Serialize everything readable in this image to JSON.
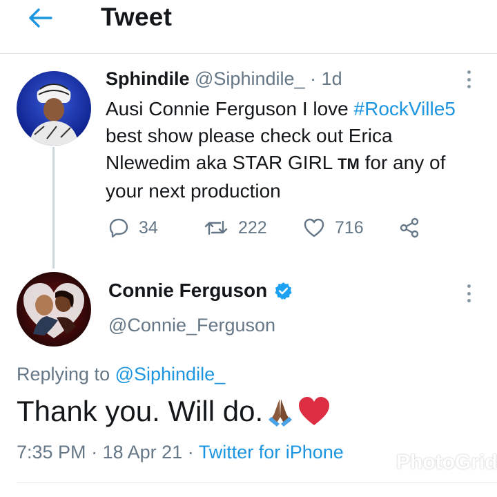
{
  "header": {
    "title": "Tweet"
  },
  "tweet1": {
    "name": "Sphindile",
    "handle": "@Siphindile_",
    "dot": "·",
    "time": "1d",
    "text_line1": "Ausi Connie Ferguson I love ",
    "hashtag": "#RockVille5",
    "text_line2": "best show please check out Erica",
    "text_line3_a": "Nlewedim aka STAR GIRL ",
    "tm": "TM",
    "text_line3_b": " for any of",
    "text_line4": "your next production",
    "replies": "34",
    "retweets": "222",
    "likes": "716"
  },
  "tweet2": {
    "name": "Connie Ferguson",
    "handle": "@Connie_Ferguson",
    "replying_prefix": "Replying to ",
    "replying_to": "@Siphindile_",
    "text": "Thank you. Will do.",
    "time": "7:35 PM",
    "sep1": "·",
    "date": "18 Apr 21",
    "sep2": "·",
    "source": "Twitter for iPhone"
  },
  "watermark": {
    "text": "PhotoGrid"
  },
  "colors": {
    "accent": "#1b95e0",
    "muted": "#657786",
    "divider": "#e1e8ed"
  },
  "icons": [
    "back-arrow-icon",
    "more-icon",
    "reply-icon",
    "retweet-icon",
    "like-icon",
    "share-icon",
    "verified-icon",
    "praying-hands-emoji",
    "heart-emoji",
    "photogrid-logo"
  ]
}
